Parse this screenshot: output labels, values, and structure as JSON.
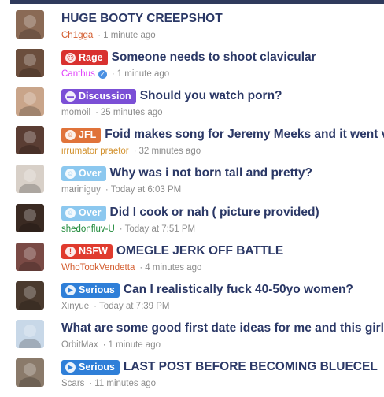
{
  "threads": [
    {
      "title": "HUGE BOOTY CREEPSHOT",
      "prefix": null,
      "prefix_icon": null,
      "prefix_color": null,
      "author": "Ch1gga",
      "author_color": "#d35c2e",
      "verified": false,
      "time": "1 minute ago",
      "avatar_tone": "#8a6a55"
    },
    {
      "title": "Someone needs to shoot clavicular",
      "prefix": "Rage",
      "prefix_icon": "angry-face-icon",
      "prefix_color": "#d9312f",
      "author": "Canthus",
      "author_color": "#e040fb",
      "verified": true,
      "time": "1 minute ago",
      "avatar_tone": "#6b4e3d"
    },
    {
      "title": "Should you watch porn?",
      "prefix": "Discussion",
      "prefix_icon": "chat-bubbles-icon",
      "prefix_color": "#7b4fd6",
      "author": "momoil",
      "author_color": "#8c8c8c",
      "verified": false,
      "time": "25 minutes ago",
      "avatar_tone": "#c9a58a"
    },
    {
      "title": "Foid makes song for Jeremy Meeks and it went viral",
      "prefix": "JFL",
      "prefix_icon": "laughing-face-icon",
      "prefix_color": "#e0733a",
      "author": "irrumator praetor",
      "author_color": "#d3922e",
      "verified": false,
      "time": "32 minutes ago",
      "avatar_tone": "#5a3d33"
    },
    {
      "title": "Why was i not born tall and pretty?",
      "prefix": "Over",
      "prefix_icon": "neutral-face-icon",
      "prefix_color": "#8cc8ef",
      "author": "mariniguy",
      "author_color": "#8c8c8c",
      "verified": false,
      "time": "Today at 6:03 PM",
      "avatar_tone": "#d8d0c8"
    },
    {
      "title": "Did I cook or nah ( picture provided)",
      "prefix": "Over",
      "prefix_icon": "neutral-face-icon",
      "prefix_color": "#8cc8ef",
      "author": "shedonfluv-U",
      "author_color": "#1f8a3a",
      "verified": false,
      "time": "Today at 7:51 PM",
      "avatar_tone": "#3a2a22"
    },
    {
      "title": "OMEGLE JERK OFF BATTLE",
      "prefix": "NSFW",
      "prefix_icon": "alert-icon",
      "prefix_color": "#e03b2e",
      "author": "WhoTookVendetta",
      "author_color": "#d35c2e",
      "verified": false,
      "time": "4 minutes ago",
      "avatar_tone": "#7a4a45"
    },
    {
      "title": "Can I realistically fuck 40-50yo women?",
      "prefix": "Serious",
      "prefix_icon": "megaphone-icon",
      "prefix_color": "#2f7fd8",
      "author": "Xinyue",
      "author_color": "#8c8c8c",
      "verified": false,
      "time": "Today at 7:39 PM",
      "avatar_tone": "#4a3a2e"
    },
    {
      "title": "What are some good first date ideas for me and this girl",
      "prefix": null,
      "prefix_icon": null,
      "prefix_color": null,
      "author": "OrbitMax",
      "author_color": "#8c8c8c",
      "verified": false,
      "time": "1 minute ago",
      "avatar_tone": "#c8d8e8"
    },
    {
      "title": "LAST POST BEFORE BECOMING BLUECEL",
      "prefix": "Serious",
      "prefix_icon": "megaphone-icon",
      "prefix_color": "#2f7fd8",
      "author": "Scars",
      "author_color": "#8c8c8c",
      "verified": false,
      "time": "11 minutes ago",
      "avatar_tone": "#8a7a6a"
    }
  ]
}
